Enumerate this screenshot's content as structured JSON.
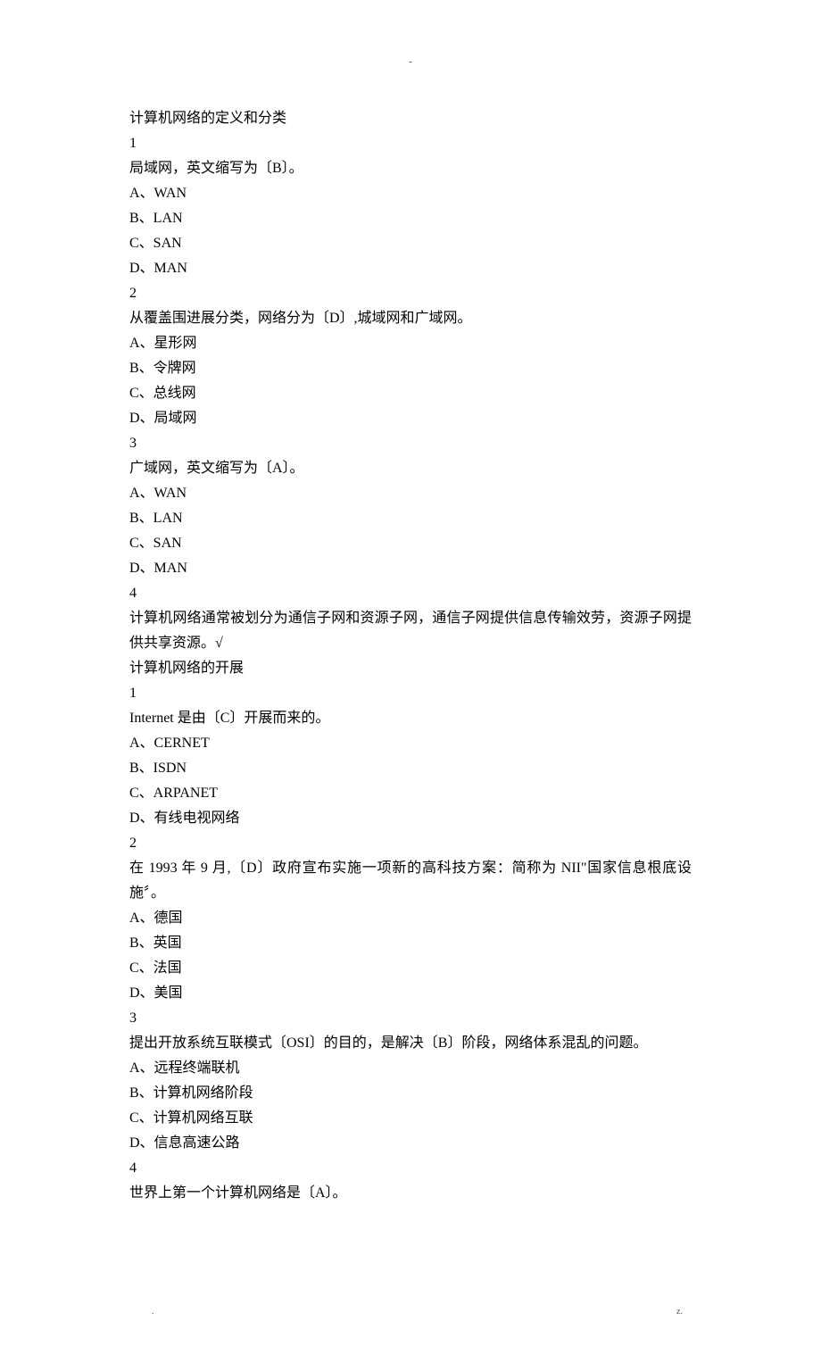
{
  "header_mark": "-",
  "footer_left": ".",
  "footer_right": "z.",
  "sections": [
    {
      "title": "计算机网络的定义和分类",
      "questions": [
        {
          "num": "1",
          "stem": "局域网，英文缩写为〔B〕。",
          "opts": [
            "A、WAN",
            "B、LAN",
            "C、SAN",
            "D、MAN"
          ]
        },
        {
          "num": "2",
          "stem": "从覆盖围进展分类，网络分为〔D〕,城域网和广域网。",
          "opts": [
            "A、星形网",
            "B、令牌网",
            "C、总线网",
            "D、局域网"
          ]
        },
        {
          "num": "3",
          "stem": "广域网，英文缩写为〔A〕。",
          "opts": [
            "A、WAN",
            "B、LAN",
            "C、SAN",
            "D、MAN"
          ]
        },
        {
          "num": "4",
          "stem": "计算机网络通常被划分为通信子网和资源子网，通信子网提供信息传输效劳，资源子网提供共享资源。√",
          "opts": []
        }
      ]
    },
    {
      "title": "计算机网络的开展",
      "questions": [
        {
          "num": "1",
          "stem": "Internet 是由〔C〕开展而来的。",
          "opts": [
            "A、CERNET",
            "B、ISDN",
            "C、ARPANET",
            "D、有线电视网络"
          ]
        },
        {
          "num": "2",
          "stem": "在 1993 年 9 月,〔D〕政府宣布实施一项新的高科技方案：简称为 NII\"国家信息根底设施〞。",
          "opts": [
            "A、德国",
            "B、英国",
            "C、法国",
            "D、美国"
          ]
        },
        {
          "num": "3",
          "stem": "提出开放系统互联模式〔OSI〕的目的，是解决〔B〕阶段，网络体系混乱的问题。",
          "opts": [
            "A、远程终端联机",
            "B、计算机网络阶段",
            "C、计算机网络互联",
            "D、信息高速公路"
          ]
        },
        {
          "num": "4",
          "stem": "世界上第一个计算机网络是〔A〕。",
          "opts": []
        }
      ]
    }
  ]
}
